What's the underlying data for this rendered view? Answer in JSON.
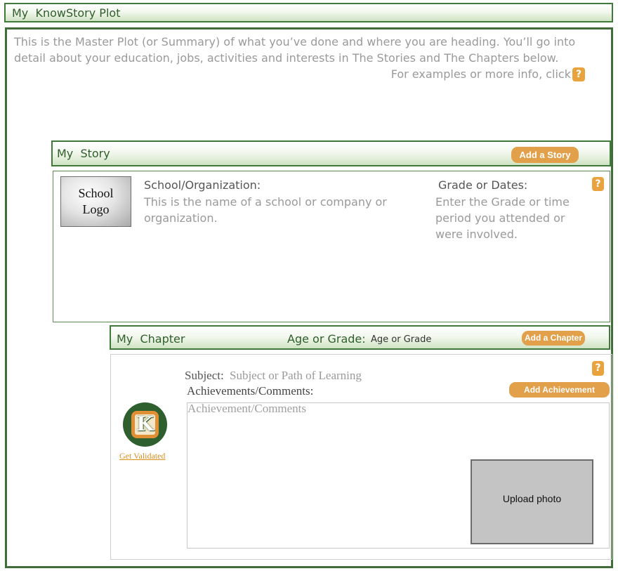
{
  "header": {
    "title": "My  KnowStory Plot"
  },
  "intro": {
    "text": "This is the Master Plot (or Summary) of what you’ve done and where you are heading.  You’ll go into detail about your education, jobs, activities and interests in The Stories and The Chapters below.",
    "examples_text": "For examples or more info, click",
    "help_label": "?"
  },
  "story": {
    "title": "My  Story",
    "add_label": "Add a Story",
    "logo_label": "School Logo",
    "school_heading": "School/Organization:",
    "school_desc": "This is the name of a school or company or organization.",
    "grade_heading": "Grade or Dates:",
    "grade_desc": "Enter the Grade or time period you attended or were involved.",
    "help_label": "?"
  },
  "chapter": {
    "title": "My  Chapter",
    "age_label": "Age or Grade:",
    "age_value": "Age or Grade",
    "add_label": "Add a Chapter",
    "help_label": "?",
    "subject_label": "Subject:",
    "subject_placeholder": "Subject or Path of Learning",
    "achievements_label": "Achievements/Comments:",
    "add_achievement_label": "Add Achievement",
    "achievements_placeholder": "Achievement/Comments",
    "badge_letter": "K",
    "validate_link": "Get Validated",
    "upload_label": "Upload photo"
  },
  "colors": {
    "brand_green": "#3f7a3a",
    "accent_orange": "#e3a04a"
  }
}
